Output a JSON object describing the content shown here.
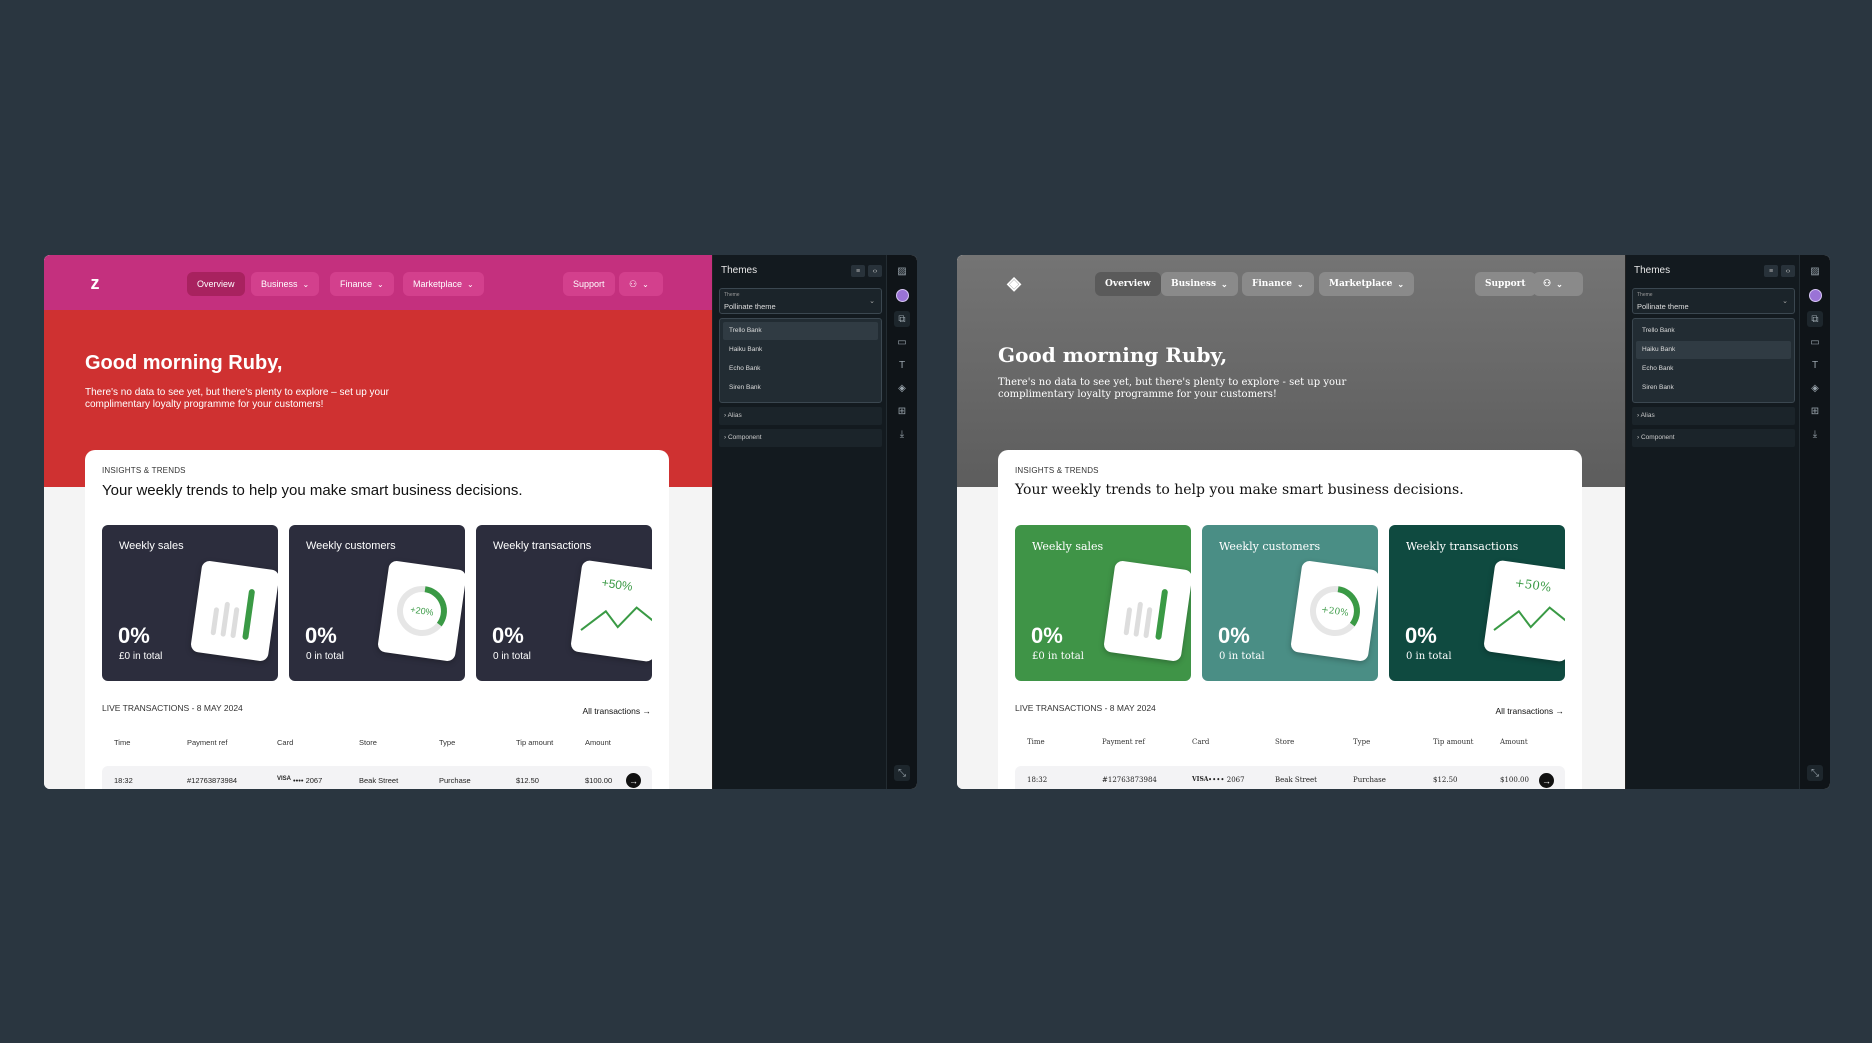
{
  "screens": [
    {
      "id": "left",
      "nav": {
        "logo": "z",
        "overview": "Overview",
        "business": "Business",
        "finance": "Finance",
        "marketplace": "Marketplace",
        "support": "Support"
      },
      "greeting": "Good morning Ruby,",
      "subtext": "There's no data to see yet, but there's plenty to explore – set up your complimentary loyalty programme for your customers!",
      "insights": {
        "kicker": "INSIGHTS & TRENDS",
        "headline": "Your weekly trends to help you make smart business decisions.",
        "tiles": [
          {
            "label": "Weekly sales",
            "pct": "0%",
            "total": "£0 in total",
            "badge": ""
          },
          {
            "label": "Weekly customers",
            "pct": "0%",
            "total": "0 in total",
            "badge": "+20%"
          },
          {
            "label": "Weekly transactions",
            "pct": "0%",
            "total": "0 in total",
            "badge": "+50%"
          }
        ]
      },
      "transactions": {
        "title": "LIVE TRANSACTIONS - 8 MAY 2024",
        "all_link": "All transactions",
        "columns": [
          "Time",
          "Payment ref",
          "Card",
          "Store",
          "Type",
          "Tip amount",
          "Amount"
        ],
        "rows": [
          {
            "time": "18:32",
            "ref": "#12763873984",
            "card_brand": "VISA",
            "card": "•••• 2067",
            "store": "Beak Street",
            "type": "Purchase",
            "tip": "$12.50",
            "amount": "$100.00"
          }
        ]
      },
      "panel": {
        "title": "Themes",
        "select_label": "Theme",
        "select_value": "Pollinate theme",
        "options": [
          "Trello Bank",
          "Haiku Bank",
          "Echo Bank",
          "Siren Bank"
        ],
        "selected_index": 0,
        "expanders": [
          "Alias",
          "Component"
        ]
      },
      "colors": {
        "nav": "#c4307e",
        "hero": "#cf3131",
        "tile": "#2c2d3d"
      }
    },
    {
      "id": "right",
      "nav": {
        "logo": "◈",
        "overview": "Overview",
        "business": "Business",
        "finance": "Finance",
        "marketplace": "Marketplace",
        "support": "Support"
      },
      "greeting": "Good morning Ruby,",
      "subtext": "There's no data to see yet, but there's plenty to explore - set up your complimentary loyalty programme for your customers!",
      "insights": {
        "kicker": "INSIGHTS & TRENDS",
        "headline": "Your weekly trends to help you make smart business decisions.",
        "tiles": [
          {
            "label": "Weekly sales",
            "pct": "0%",
            "total": "£0 in total",
            "badge": ""
          },
          {
            "label": "Weekly customers",
            "pct": "0%",
            "total": "0 in total",
            "badge": "+20%"
          },
          {
            "label": "Weekly transactions",
            "pct": "0%",
            "total": "0 in total",
            "badge": "+50%"
          }
        ]
      },
      "transactions": {
        "title": "LIVE TRANSACTIONS - 8 MAY 2024",
        "all_link": "All transactions",
        "columns": [
          "Time",
          "Payment ref",
          "Card",
          "Store",
          "Type",
          "Tip amount",
          "Amount"
        ],
        "rows": [
          {
            "time": "18:32",
            "ref": "#12763873984",
            "card_brand": "VISA",
            "card": "•••• 2067",
            "store": "Beak Street",
            "type": "Purchase",
            "tip": "$12.50",
            "amount": "$100.00"
          }
        ]
      },
      "panel": {
        "title": "Themes",
        "select_label": "Theme",
        "select_value": "Pollinate theme",
        "options": [
          "Trello Bank",
          "Haiku Bank",
          "Echo Bank",
          "Siren Bank"
        ],
        "selected_index": 1,
        "expanders": [
          "Alias",
          "Component"
        ]
      },
      "colors": {
        "hero": "#6a6a6a",
        "tile_sales": "#3f9447",
        "tile_customers": "#4a8e85",
        "tile_transactions": "#0f4a40"
      }
    }
  ]
}
